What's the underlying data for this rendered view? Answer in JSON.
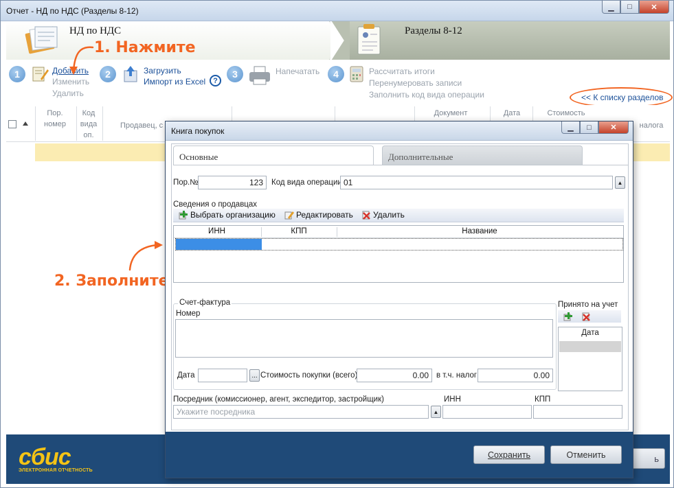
{
  "window": {
    "title": "Отчет - НД по НДС (Разделы 8-12)",
    "btn_min": "▁",
    "btn_max": "□",
    "btn_close": "✕"
  },
  "header": {
    "step_left": "НД по НДС",
    "step_right": "Разделы 8-12"
  },
  "steps": {
    "s1": {
      "num": "1",
      "add": "Добавить",
      "edit": "Изменить",
      "delete": "Удалить"
    },
    "s2": {
      "num": "2",
      "load": "Загрузить",
      "import_excel": "Импорт из Excel",
      "help": "?"
    },
    "s3": {
      "num": "3",
      "print": "Напечатать"
    },
    "s4": {
      "num": "4",
      "calc": "Рассчитать итоги",
      "renumber": "Перенумеровать записи",
      "fill_code": "Заполнить код вида операции"
    },
    "back_link": "<< К списку разделов"
  },
  "grid": {
    "headers": [
      "Пор. номер",
      "Код вида оп.",
      "Продавец, с",
      "Документ",
      "Дата",
      "Стоимость",
      "налога"
    ]
  },
  "annotations": {
    "a1": "1. Нажмите",
    "a2": "2. Заполните"
  },
  "footer": {
    "logo": "сбис",
    "logo_sub": "ЭЛЕКТРОННАЯ ОТЧЕТНОСТЬ",
    "partial_btn": "ь"
  },
  "dialog": {
    "title": "Книга покупок",
    "tabs": [
      "Основные",
      "Дополнительные"
    ],
    "por_label": "Пор.№",
    "por_value": "123",
    "kod_label": "Код вида операции",
    "kod_value": "01",
    "sellers_label": "Сведения о продавцах",
    "toolbar": {
      "select_org": "Выбрать организацию",
      "edit": "Редактировать",
      "delete": "Удалить"
    },
    "table_headers": [
      "ИНН",
      "КПП",
      "Название"
    ],
    "invoice_group": "Счет-фактура",
    "nomer_label": "Номер",
    "date_label": "Дата",
    "date_btn": "...",
    "cost_label": "Стоимость покупки (всего)",
    "cost_value": "0.00",
    "tax_label": "в т.ч. налог",
    "tax_value": "0.00",
    "accepted_label": "Принято на учет",
    "accepted_col": "Дата",
    "intermediary_label": "Посредник (комиссионер, агент, экспедитор, застройщик)",
    "intermediary_placeholder": "Укажите посредника",
    "inn_label": "ИНН",
    "kpp_label": "КПП",
    "save": "Сохранить",
    "cancel": "Отменить"
  },
  "colors": {
    "accent": "#f26522",
    "footer": "#1f4a78",
    "link": "#1a4f98",
    "selection": "#3c8ee6",
    "highlight_row": "#fbecb2"
  }
}
